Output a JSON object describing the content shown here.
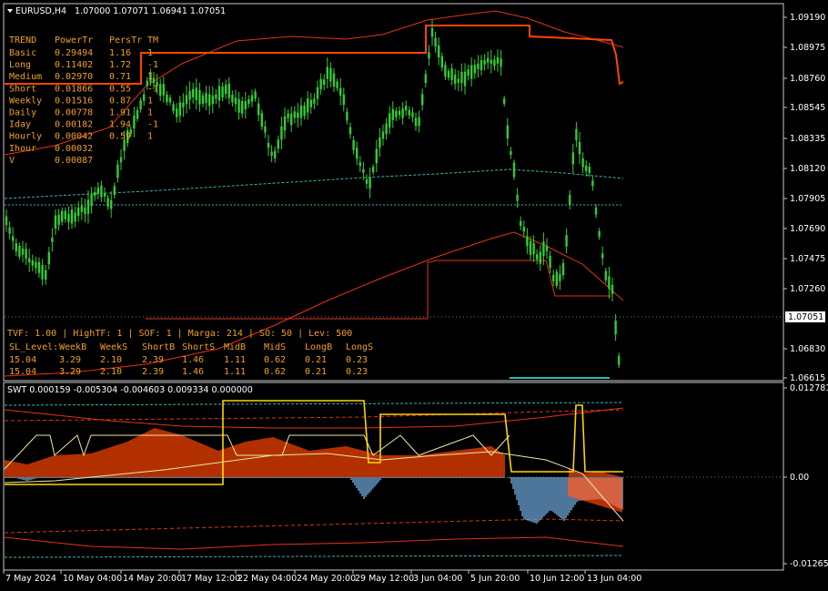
{
  "header": {
    "symbol": "EURUSD,H4",
    "ohlc": "1.07000 1.07071 1.06941 1.07051"
  },
  "price_axis": {
    "labels": [
      "1.09190",
      "1.08975",
      "1.08760",
      "1.08545",
      "1.08335",
      "1.08120",
      "1.07905",
      "1.07690",
      "1.07475",
      "1.07260",
      "1.07051",
      "1.06830",
      "1.06615"
    ],
    "current": "1.07051"
  },
  "trend_table": {
    "headers": [
      "TREND",
      "PowerTr",
      "PersTr",
      "TM"
    ],
    "rows": [
      [
        "Basic",
        "0.29494",
        "1.16",
        "1"
      ],
      [
        "Long",
        "0.11402",
        "1.72",
        "-1"
      ],
      [
        "Medium",
        "0.02970",
        "0.71",
        "1"
      ],
      [
        "Short",
        "0.01866",
        "0.55",
        "-1"
      ],
      [
        "Weekly",
        "0.01516",
        "0.87",
        "1"
      ],
      [
        "Daily",
        "0.00778",
        "1.91",
        "1"
      ],
      [
        "Iday",
        "0.00182",
        "1.94",
        "-1"
      ],
      [
        "Hourly",
        "0.00042",
        "0.59",
        "1"
      ],
      [
        "Ihour",
        "0.00032",
        "",
        ""
      ],
      [
        "V",
        "0.00087",
        "",
        ""
      ]
    ]
  },
  "sl_panel": {
    "info": "TVF: 1.00 | HighTF: 1 | SOF: 1 | Marga: 214 | SO: 50 | Lev: 500",
    "headers": [
      "SL_Level:",
      "WeekB",
      "WeekS",
      "ShortB",
      "ShortS",
      "MidB",
      "MidS",
      "LongB",
      "LongS"
    ],
    "rows": [
      [
        "15.04",
        "3.29",
        "2.10",
        "2.39",
        "1.46",
        "1.11",
        "0.62",
        "0.21",
        "0.23"
      ],
      [
        "15.04",
        "3.29",
        "2.10",
        "2.39",
        "1.46",
        "1.11",
        "0.62",
        "0.21",
        "0.23"
      ]
    ]
  },
  "indicator": {
    "title": "SWT 0.000159 -0.005304 -0.004603 0.009334 0.000000",
    "axis_labels": [
      "0.012781",
      "0.00",
      "-0.012658"
    ]
  },
  "time_axis": {
    "labels": [
      "7 May 2024",
      "10 May 04:00",
      "14 May 20:00",
      "17 May 12:00",
      "22 May 04:00",
      "24 May 20:00",
      "29 May 12:00",
      "3 Jun 04:00",
      "5 Jun 20:00",
      "10 Jun 12:00",
      "13 Jun 04:00"
    ]
  },
  "colors": {
    "background": "#000000",
    "bull_candle": "#32cd32",
    "trend_line": "#ff4500",
    "envelope": "#e8311a",
    "ma_cyan": "#2fb7b7",
    "histogram_blue": "#6fa8dc",
    "histogram_orange": "#ff4500",
    "signal_yellow": "#ffd400"
  }
}
